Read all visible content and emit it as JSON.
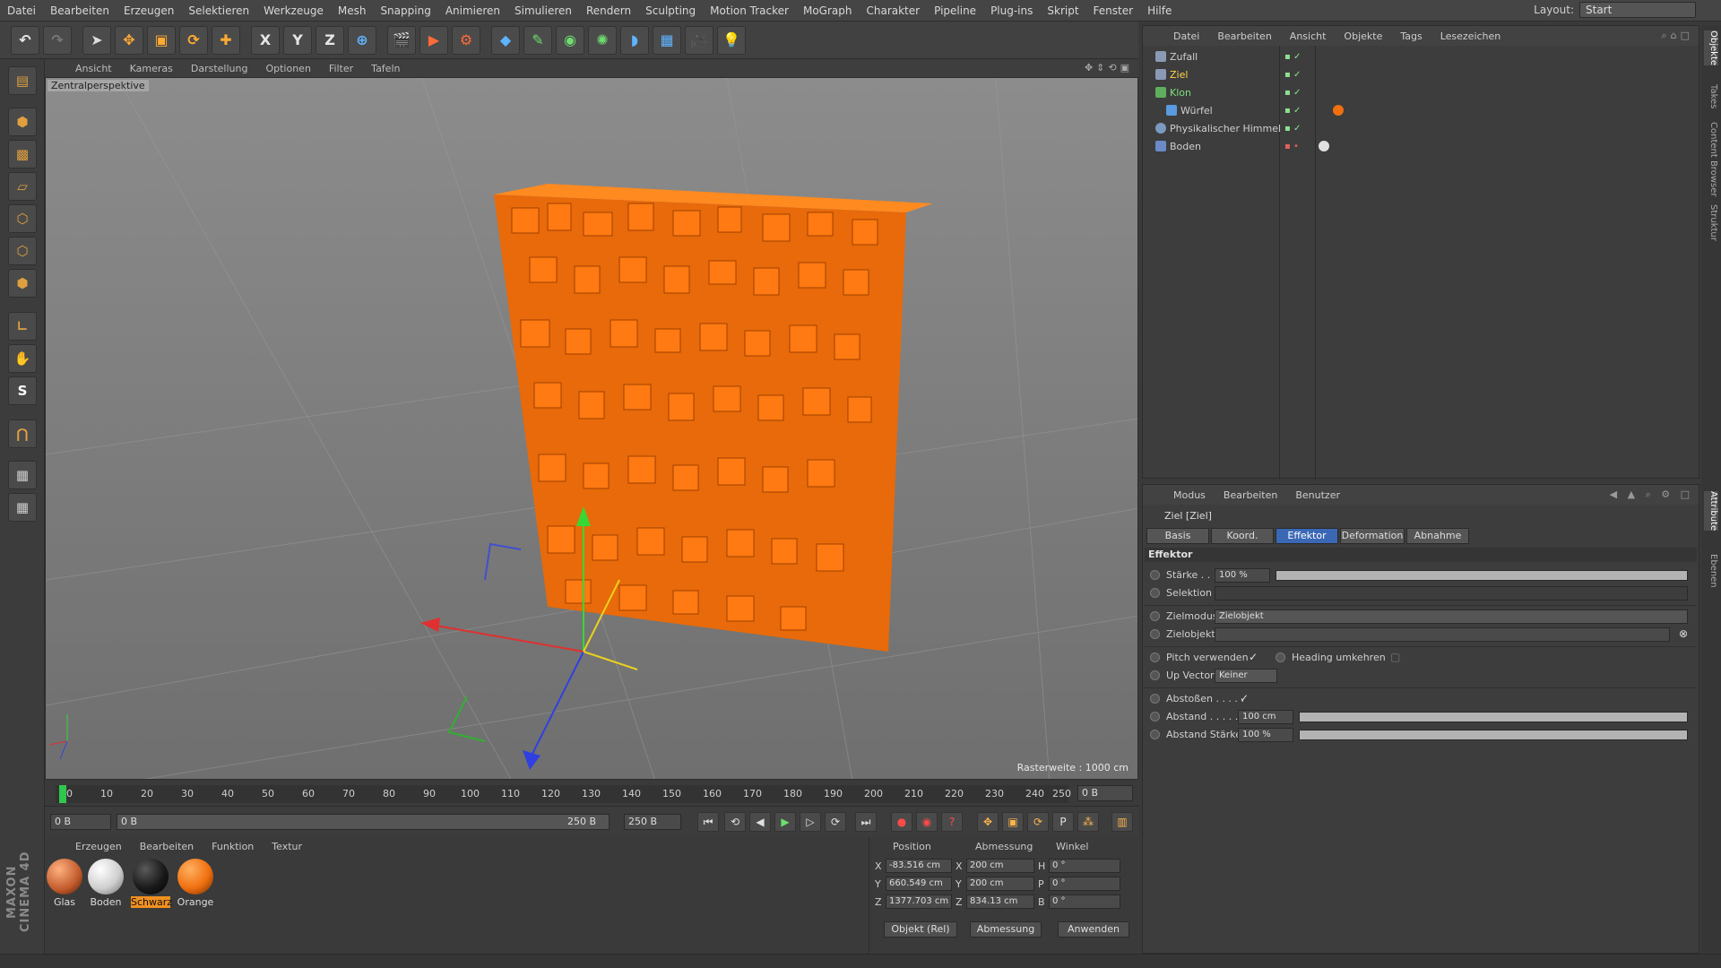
{
  "menubar": {
    "items": [
      "Datei",
      "Bearbeiten",
      "Erzeugen",
      "Selektieren",
      "Werkzeuge",
      "Mesh",
      "Snapping",
      "Animieren",
      "Simulieren",
      "Rendern",
      "Sculpting",
      "Motion Tracker",
      "MoGraph",
      "Charakter",
      "Pipeline",
      "Plug-ins",
      "Skript",
      "Fenster",
      "Hilfe"
    ],
    "layout_label": "Layout:",
    "layout_value": "Start"
  },
  "toolbar": {
    "axis_x": "X",
    "axis_y": "Y",
    "axis_z": "Z"
  },
  "lefttools": {
    "snap_label": "S"
  },
  "brand": "MAXON CINEMA 4D",
  "viewport": {
    "menu": [
      "Ansicht",
      "Kameras",
      "Darstellung",
      "Optionen",
      "Filter",
      "Tafeln"
    ],
    "camera_label": "Zentralperspektive",
    "raster": "Rasterweite : 1000 cm"
  },
  "timeline": {
    "ticks": [
      "0",
      "10",
      "20",
      "30",
      "40",
      "50",
      "60",
      "70",
      "80",
      "90",
      "100",
      "110",
      "120",
      "130",
      "140",
      "150",
      "160",
      "170",
      "180",
      "190",
      "200",
      "210",
      "220",
      "230",
      "240",
      "250"
    ],
    "current_frame": "0 B"
  },
  "transport": {
    "start_field": "0 B",
    "range_start": "0 B",
    "range_end": "250 B",
    "end_field": "250 B"
  },
  "materials": {
    "menu": [
      "Erzeugen",
      "Bearbeiten",
      "Funktion",
      "Textur"
    ],
    "items": [
      {
        "name": "Glas",
        "color": "#c05a2a"
      },
      {
        "name": "Boden",
        "color": "#dcdcdc"
      },
      {
        "name": "Schwarz",
        "color": "#1a1a1a"
      },
      {
        "name": "Orange",
        "color": "#f07010"
      }
    ]
  },
  "coords": {
    "headers": [
      "Position",
      "Abmessung",
      "Winkel"
    ],
    "rows": [
      {
        "axis": "X",
        "pos": "-83.516 cm",
        "size_axis": "X",
        "size": "200 cm",
        "rot_axis": "H",
        "rot": "0 °"
      },
      {
        "axis": "Y",
        "pos": "660.549 cm",
        "size_axis": "Y",
        "size": "200 cm",
        "rot_axis": "P",
        "rot": "0 °"
      },
      {
        "axis": "Z",
        "pos": "1377.703 cm",
        "size_axis": "Z",
        "size": "834.13 cm",
        "rot_axis": "B",
        "rot": "0 °"
      }
    ],
    "mode_button": "Objekt (Rel)",
    "size_button": "Abmessung",
    "apply_button": "Anwenden"
  },
  "objects": {
    "menu": [
      "Datei",
      "Bearbeiten",
      "Ansicht",
      "Objekte",
      "Tags",
      "Lesezeichen"
    ],
    "items": [
      {
        "name": "Zufall",
        "color": "#cfcfcf"
      },
      {
        "name": "Ziel",
        "color": "#ffd24a"
      },
      {
        "name": "Klon",
        "color": "#7fdf7f"
      },
      {
        "name": "Würfel",
        "color": "#cfcfcf"
      },
      {
        "name": "Physikalischer Himmel",
        "color": "#cfcfcf"
      },
      {
        "name": "Boden",
        "color": "#cfcfcf"
      }
    ]
  },
  "attributes": {
    "menu": [
      "Modus",
      "Bearbeiten",
      "Benutzer"
    ],
    "title": "Ziel [Ziel]",
    "tabs": [
      "Basis",
      "Koord.",
      "Effektor",
      "Deformation",
      "Abnahme"
    ],
    "active_tab": "Effektor",
    "section": "Effektor",
    "staerke_label": "Stärke . . . .",
    "staerke_value": "100 %",
    "selektion_label": "Selektion",
    "zielmodus_label": "Zielmodus",
    "zielmodus_value": "Zielobjekt",
    "zielobjekt_label": "Zielobjekt",
    "pitch_label": "Pitch verwenden",
    "heading_label": "Heading umkehren",
    "upvector_label": "Up Vector",
    "upvector_value": "Keiner",
    "abstossen_label": "Abstoßen . . . . .",
    "abstand_label": "Abstand . . . . . .",
    "abstand_value": "100 cm",
    "abstand_staerke_label": "Abstand Stärke",
    "abstand_staerke_value": "100 %"
  },
  "right_strip": [
    "Objekte",
    "Takes",
    "Content Browser",
    "Struktur",
    "Attribute",
    "Ebenen"
  ]
}
